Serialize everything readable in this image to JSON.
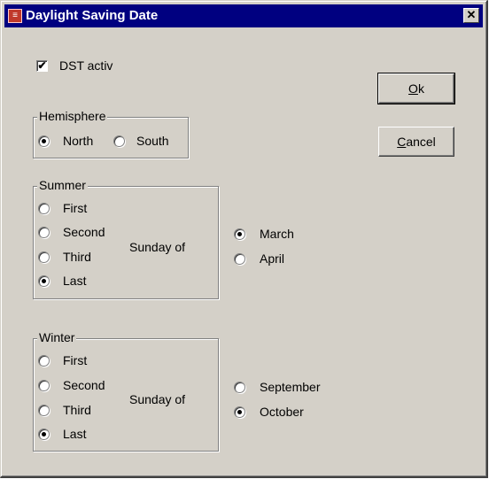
{
  "window": {
    "title": "Daylight Saving Date",
    "close_glyph": "✕"
  },
  "dst": {
    "label": "DST activ",
    "checked": true
  },
  "hemisphere": {
    "legend": "Hemisphere",
    "options": [
      "North",
      "South"
    ],
    "selected": "North"
  },
  "summer": {
    "legend": "Summer",
    "weeks": [
      "First",
      "Second",
      "Third",
      "Last"
    ],
    "selected_week": "Last",
    "sunday_of": "Sunday of",
    "months": [
      "March",
      "April"
    ],
    "selected_month": "March"
  },
  "winter": {
    "legend": "Winter",
    "weeks": [
      "First",
      "Second",
      "Third",
      "Last"
    ],
    "selected_week": "Last",
    "sunday_of": "Sunday of",
    "months": [
      "September",
      "October"
    ],
    "selected_month": "October"
  },
  "buttons": {
    "ok_mnemonic": "O",
    "ok_rest": "k",
    "cancel_mnemonic": "C",
    "cancel_rest": "ancel"
  },
  "colors": {
    "titlebar": "#000080",
    "face": "#d4d0c8"
  }
}
